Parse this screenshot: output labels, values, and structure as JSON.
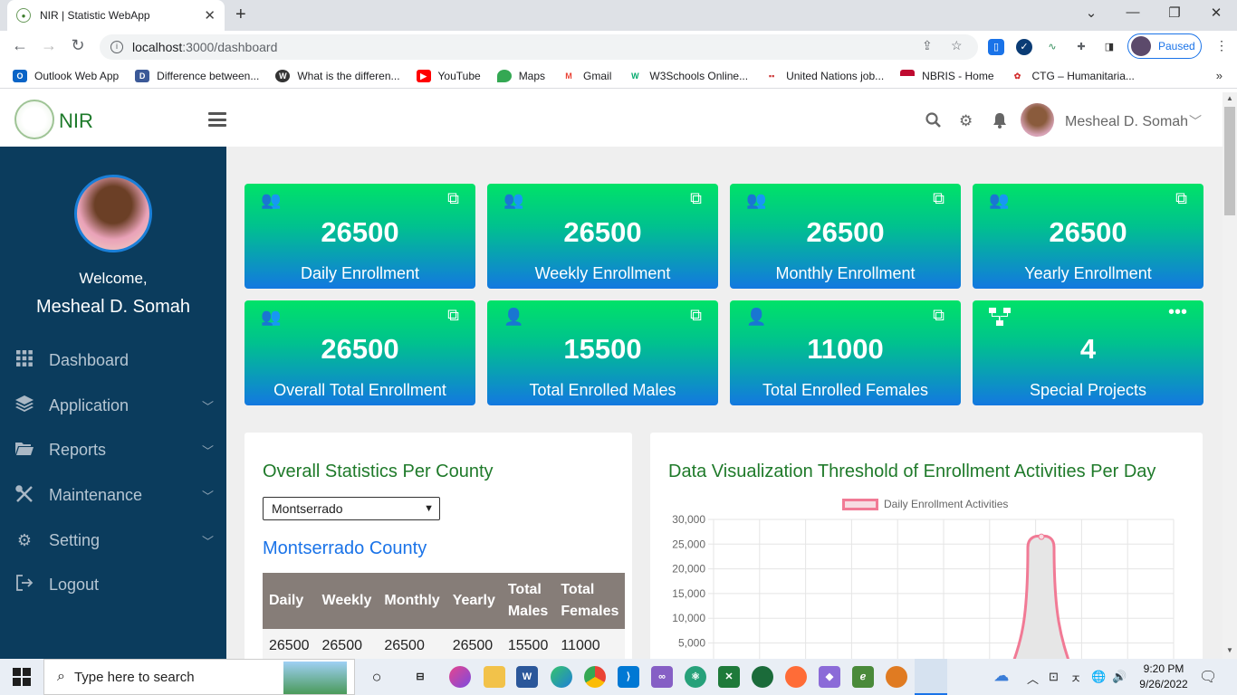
{
  "browser": {
    "tab_title": "NIR | Statistic WebApp",
    "url_host": "localhost",
    "url_path": ":3000/dashboard",
    "profile_status": "Paused",
    "bookmarks": [
      {
        "label": "Outlook Web App",
        "color": "#0a64c7",
        "glyph": "O"
      },
      {
        "label": "Difference between...",
        "color": "#3b5998",
        "glyph": "D"
      },
      {
        "label": "What is the differen...",
        "color": "#333333",
        "glyph": "W"
      },
      {
        "label": "YouTube",
        "color": "#ff0000",
        "glyph": "▶"
      },
      {
        "label": "Maps",
        "color": "#34a853",
        "glyph": "M"
      },
      {
        "label": "Gmail",
        "color": "#ea4335",
        "glyph": "M"
      },
      {
        "label": "W3Schools Online...",
        "color": "#04aa6d",
        "glyph": "W"
      },
      {
        "label": "United Nations job...",
        "color": "#ffffff",
        "glyph": ""
      },
      {
        "label": "NBRIS - Home",
        "color": "#bf0a30",
        "glyph": "N"
      },
      {
        "label": "CTG – Humanitaria...",
        "color": "#d32f2f",
        "glyph": "C"
      }
    ]
  },
  "header": {
    "brand": "NIR",
    "user_name": "Mesheal D. Somah"
  },
  "sidebar": {
    "welcome": "Welcome,",
    "name": "Mesheal D. Somah",
    "items": [
      {
        "label": "Dashboard",
        "icon": "grid-icon",
        "glyph": "▦",
        "has_chevron": false
      },
      {
        "label": "Application",
        "icon": "layers-icon",
        "glyph": "◈",
        "has_chevron": true
      },
      {
        "label": "Reports",
        "icon": "folder-icon",
        "glyph": "▰",
        "has_chevron": true
      },
      {
        "label": "Maintenance",
        "icon": "tools-icon",
        "glyph": "✂",
        "has_chevron": true
      },
      {
        "label": "Setting",
        "icon": "gear-icon",
        "glyph": "⚙",
        "has_chevron": true
      },
      {
        "label": "Logout",
        "icon": "logout-icon",
        "glyph": "⇥",
        "has_chevron": false
      }
    ]
  },
  "cards": [
    {
      "value": "26500",
      "label": "Daily Enrollment",
      "icon": "users-icon",
      "action_icon": "external-link-icon"
    },
    {
      "value": "26500",
      "label": "Weekly Enrollment",
      "icon": "users-icon",
      "action_icon": "external-link-icon"
    },
    {
      "value": "26500",
      "label": "Monthly Enrollment",
      "icon": "users-icon",
      "action_icon": "external-link-icon"
    },
    {
      "value": "26500",
      "label": "Yearly Enrollment",
      "icon": "users-icon",
      "action_icon": "external-link-icon"
    },
    {
      "value": "26500",
      "label": "Overall Total Enrollment",
      "icon": "users-icon",
      "action_icon": "external-link-icon"
    },
    {
      "value": "15500",
      "label": "Total Enrolled Males",
      "icon": "user-icon",
      "action_icon": "external-link-icon"
    },
    {
      "value": "11000",
      "label": "Total Enrolled Females",
      "icon": "user-icon",
      "action_icon": "external-link-icon"
    },
    {
      "value": "4",
      "label": "Special Projects",
      "icon": "sitemap-icon",
      "action_icon": "more-icon"
    }
  ],
  "county_panel": {
    "title": "Overall Statistics Per County",
    "selected_county": "Montserrado",
    "county_heading": "Montserrado County",
    "table": {
      "headers": [
        "Daily",
        "Weekly",
        "Monthly",
        "Yearly",
        "Total Males",
        "Total Females"
      ],
      "rows": [
        [
          "26500",
          "26500",
          "26500",
          "26500",
          "15500",
          "11000"
        ]
      ]
    }
  },
  "chart_panel": {
    "title": "Data Visualization Threshold of Enrollment Activities Per Day"
  },
  "chart_data": {
    "type": "area",
    "series": [
      {
        "name": "Daily Enrollment Activities",
        "color": "#f17a95",
        "fill": "#e6e6e6"
      }
    ],
    "ylim": [
      0,
      30000
    ],
    "yticks": [
      "30,000",
      "25,000",
      "20,000",
      "15,000",
      "10,000",
      "5,000"
    ],
    "peak_value": 26500
  },
  "taskbar": {
    "search_placeholder": "Type here to search",
    "time": "9:20 PM",
    "date": "9/26/2022"
  }
}
